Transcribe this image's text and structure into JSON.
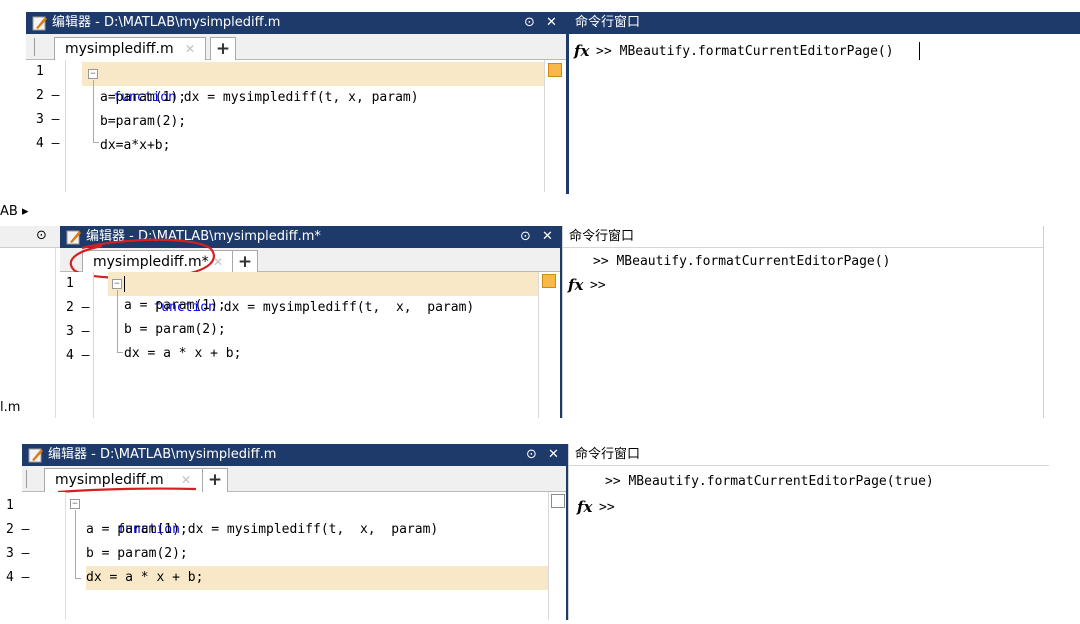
{
  "panels": [
    {
      "editor_title": "编辑器 - D:\\MATLAB\\mysimplediff.m",
      "tab_label": "mysimplediff.m",
      "cmd_title": "命令行窗口",
      "cmd_history": "",
      "cmd_prompt": "> MBeautify.formatCurrentEditorPage()",
      "code": {
        "l1_num": "1",
        "l1_kw": "function",
        "l1_rest": " dx = mysimplediff(t, x, param)",
        "l2_num": "2 —",
        "l2": "a=param(1);",
        "l3_num": "3 —",
        "l3": "b=param(2);",
        "l4_num": "4 —",
        "l4": "dx=a*x+b;"
      }
    },
    {
      "editor_title": "编辑器 - D:\\MATLAB\\mysimplediff.m*",
      "tab_label": "mysimplediff.m*",
      "cmd_title": "命令行窗口",
      "cmd_history": ">> MBeautify.formatCurrentEditorPage()",
      "cmd_prompt": "",
      "code": {
        "l1_num": "1",
        "l1_kw": "function",
        "l1_rest": " dx = mysimplediff(t,  x,  param)",
        "l2_num": "2 —",
        "l2": "a = param(1);",
        "l3_num": "3 —",
        "l3": "b = param(2);",
        "l4_num": "4 —",
        "l4": "dx = a * x + b;"
      }
    },
    {
      "editor_title": "编辑器 - D:\\MATLAB\\mysimplediff.m",
      "tab_label": "mysimplediff.m",
      "cmd_title": "命令行窗口",
      "cmd_history": ">> MBeautify.formatCurrentEditorPage(true)",
      "cmd_prompt": "",
      "code": {
        "l1_num": "1",
        "l1_kw": "function",
        "l1_rest": " dx = mysimplediff(t,  x,  param)",
        "l2_num": "2 —",
        "l2": "a = param(1);",
        "l3_num": "3 —",
        "l3": "b = param(2);",
        "l4_num": "4 —",
        "l4": "dx = a * x + b;"
      }
    }
  ],
  "misc": {
    "breadcrumb_fragment": "AB ▸",
    "file_fragment": "l.m",
    "prompt_marker": ">>",
    "fx_symbol": "fx",
    "tab_close": "✕",
    "tab_add": "+",
    "titlebar_menu": "⊙",
    "titlebar_close": "✕"
  },
  "colors": {
    "titlebar": "#1e3a6b",
    "keyword": "#0000ff",
    "highlight": "#f8e8c8",
    "annotation_red": "#d42020"
  }
}
